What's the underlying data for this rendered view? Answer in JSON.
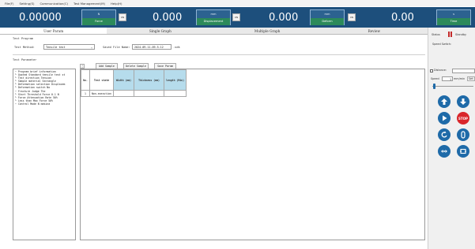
{
  "menu": [
    "File(F)",
    "Setting(S)",
    "Communication(C)",
    "Test Management(M)",
    "Help(H)"
  ],
  "displays": [
    {
      "value": "0.00000",
      "unit": "N",
      "mode": "Force",
      "zero": "0N"
    },
    {
      "value": "0.000",
      "unit": "mm",
      "mode": "Displacement",
      "zero": "0N"
    },
    {
      "value": "0.000",
      "unit": "mm",
      "mode": "Deform",
      "zero": "0N"
    },
    {
      "value": "0.00",
      "unit": "s",
      "mode": "Time",
      "zero": ""
    }
  ],
  "tabs": [
    "User Param",
    "Single Graph",
    "Multiple Graph",
    "Review"
  ],
  "test_program": {
    "section_label": "Test Program",
    "method_label": "Test Method:",
    "method_value": "Tensile test",
    "saved_label": "Saved File Name:",
    "saved_value": "2024-09-11-09-5-12",
    "saved_ext": ".sdk"
  },
  "test_parameter": {
    "section_label": "Test Parameter",
    "buttons": [
      "Add Sample",
      "Delete Sample",
      "Save Param"
    ]
  },
  "tree": [
    "− Program brief information",
    "  └ Quoted Standard tensile test st",
    "  └ Test direction Tension",
    "  └ Sample material Sectangle",
    "  └ Deformation selection Displacem",
    "  └ Deformation switch  No",
    "− Fracture Judge The",
    "  └ Start Threshold Force 0.1 N",
    "  └ Force Attenuation Rate 50%",
    "  └ Less than Max Force 50%",
    "− Control Mode N makina"
  ],
  "table": {
    "headers": [
      "No.",
      "Test state",
      "Width (mm)",
      "Thickness (mm)",
      "length (Min)"
    ],
    "rows": [
      [
        "1",
        "Non-execution",
        "",
        "",
        ""
      ]
    ]
  },
  "panel": {
    "status_label": "Status",
    "status_value": "Standby",
    "speed_switch": "Speed Switch:",
    "distance_label": "Distance:",
    "speed_label": "Speed",
    "speed_value": "1",
    "speed_unit": "mm/min",
    "speed_btn": "Set",
    "stop": "STOP"
  },
  "colors": {
    "topbar": "#1d4f7c",
    "accent": "#1e6aa8",
    "stop": "#d9262b",
    "header_cell": "#b6dcec"
  }
}
